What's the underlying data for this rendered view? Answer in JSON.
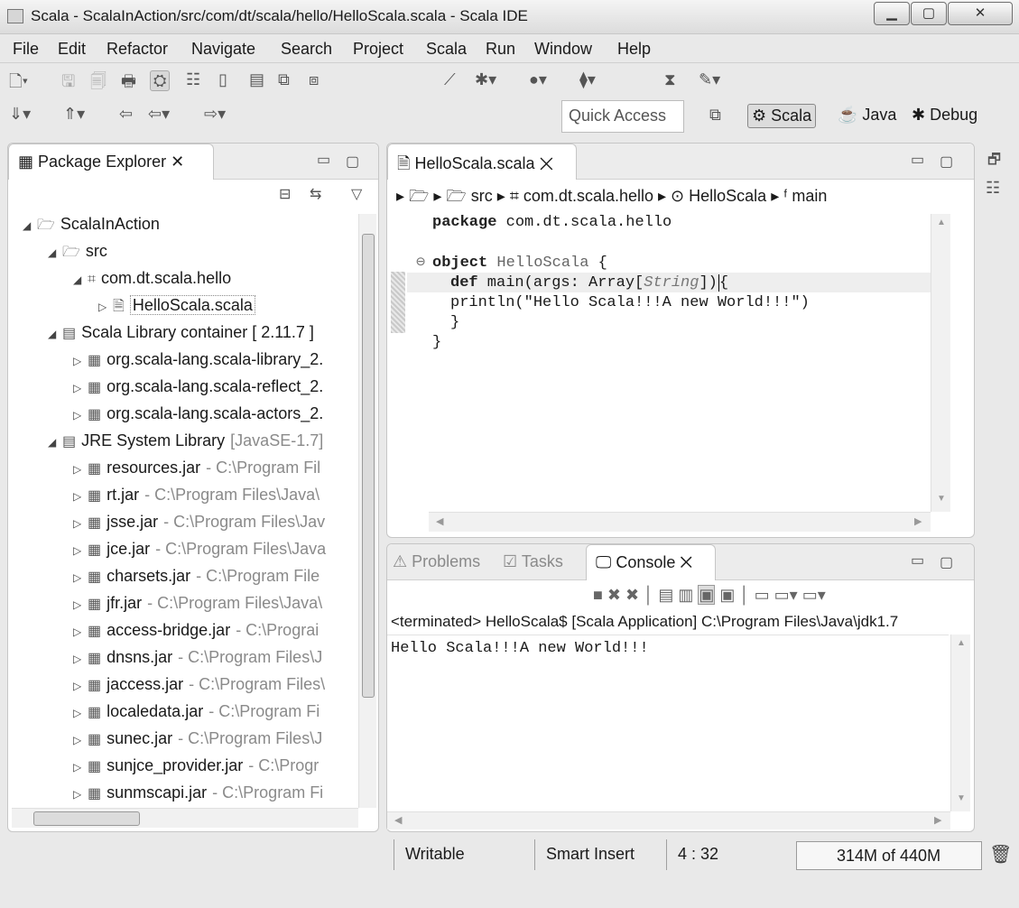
{
  "window": {
    "title": "Scala - ScalaInAction/src/com/dt/scala/hello/HelloScala.scala - Scala IDE",
    "minimize": "▁",
    "maximize": "▢",
    "close": "✕"
  },
  "menu": [
    "File",
    "Edit",
    "Refactor",
    "Navigate",
    "Search",
    "Project",
    "Scala",
    "Run",
    "Window",
    "Help"
  ],
  "quick_access": {
    "placeholder": "Quick Access"
  },
  "perspectives": [
    {
      "label": "Scala",
      "active": true
    },
    {
      "label": "Java"
    },
    {
      "label": "Debug"
    }
  ],
  "package_explorer": {
    "tab": "Package Explorer",
    "tree": [
      {
        "label": "ScalaInAction",
        "twisty": "◢",
        "icon": "project-icon",
        "glyph": "🗁"
      },
      {
        "label": "src",
        "twisty": "◢",
        "icon": "source-folder-icon",
        "glyph": "🗁"
      },
      {
        "label": "com.dt.scala.hello",
        "twisty": "◢",
        "icon": "package-icon",
        "glyph": "⌗"
      },
      {
        "label": "HelloScala.scala",
        "twisty": "▷",
        "icon": "scala-file-icon",
        "glyph": "🗎",
        "selected": true
      },
      {
        "label": "Scala Library container [ 2.11.7 ]",
        "twisty": "◢",
        "icon": "library-icon",
        "glyph": "▤"
      },
      {
        "label": "org.scala-lang.scala-library_2.",
        "twisty": "▷",
        "icon": "jar-icon",
        "glyph": "▦"
      },
      {
        "label": "org.scala-lang.scala-reflect_2.",
        "twisty": "▷",
        "icon": "jar-icon",
        "glyph": "▦"
      },
      {
        "label": "org.scala-lang.scala-actors_2.",
        "twisty": "▷",
        "icon": "jar-icon",
        "glyph": "▦"
      },
      {
        "label": "JRE System Library",
        "suffix": "[JavaSE-1.7]",
        "twisty": "◢",
        "icon": "library-icon",
        "glyph": "▤"
      },
      {
        "label": "resources.jar",
        "suffix": "- C:\\Program Fil",
        "twisty": "▷",
        "icon": "jar-icon",
        "glyph": "▦"
      },
      {
        "label": "rt.jar",
        "suffix": "- C:\\Program Files\\Java\\",
        "twisty": "▷",
        "icon": "jar-icon",
        "glyph": "▦"
      },
      {
        "label": "jsse.jar",
        "suffix": "- C:\\Program Files\\Jav",
        "twisty": "▷",
        "icon": "jar-icon",
        "glyph": "▦"
      },
      {
        "label": "jce.jar",
        "suffix": "- C:\\Program Files\\Java",
        "twisty": "▷",
        "icon": "jar-icon",
        "glyph": "▦"
      },
      {
        "label": "charsets.jar",
        "suffix": "- C:\\Program File",
        "twisty": "▷",
        "icon": "jar-icon",
        "glyph": "▦"
      },
      {
        "label": "jfr.jar",
        "suffix": "- C:\\Program Files\\Java\\",
        "twisty": "▷",
        "icon": "jar-icon",
        "glyph": "▦"
      },
      {
        "label": "access-bridge.jar",
        "suffix": "- C:\\Prograi",
        "twisty": "▷",
        "icon": "jar-icon",
        "glyph": "▦"
      },
      {
        "label": "dnsns.jar",
        "suffix": "- C:\\Program Files\\J",
        "twisty": "▷",
        "icon": "jar-icon",
        "glyph": "▦"
      },
      {
        "label": "jaccess.jar",
        "suffix": "- C:\\Program Files\\",
        "twisty": "▷",
        "icon": "jar-icon",
        "glyph": "▦"
      },
      {
        "label": "localedata.jar",
        "suffix": "- C:\\Program Fi",
        "twisty": "▷",
        "icon": "jar-icon",
        "glyph": "▦"
      },
      {
        "label": "sunec.jar",
        "suffix": "- C:\\Program Files\\J",
        "twisty": "▷",
        "icon": "jar-icon",
        "glyph": "▦"
      },
      {
        "label": "sunjce_provider.jar",
        "suffix": "- C:\\Progr",
        "twisty": "▷",
        "icon": "jar-icon",
        "glyph": "▦"
      },
      {
        "label": "sunmscapi.jar",
        "suffix": "- C:\\Program Fi",
        "twisty": "▷",
        "icon": "jar-icon",
        "glyph": "▦"
      }
    ]
  },
  "editor": {
    "tab": "HelloScala.scala",
    "breadcrumb": [
      "src",
      "com.dt.scala.hello",
      "HelloScala",
      "main"
    ],
    "code": {
      "l1_kw": "package",
      "l1_rest": " com.dt.scala.hello",
      "l2_kw": "object",
      "l2_name": " HelloScala",
      "l2_rest": " {",
      "l3_kw": "def",
      "l3_a": " main(args: Array[",
      "l3_type": "String",
      "l3_b": "])",
      "l4": "println(\"Hello Scala!!!A new World!!!\")",
      "l5": "}",
      "l6": "}"
    }
  },
  "bottom": {
    "tabs": [
      "Problems",
      "Tasks",
      "Console"
    ],
    "active_tab": "Console",
    "console_header": "<terminated> HelloScala$ [Scala Application] C:\\Program Files\\Java\\jdk1.7",
    "console_output": "Hello Scala!!!A new World!!!"
  },
  "status": {
    "mode": "Writable",
    "insert": "Smart Insert",
    "position": "4 : 32",
    "memory": "314M of 440M"
  }
}
